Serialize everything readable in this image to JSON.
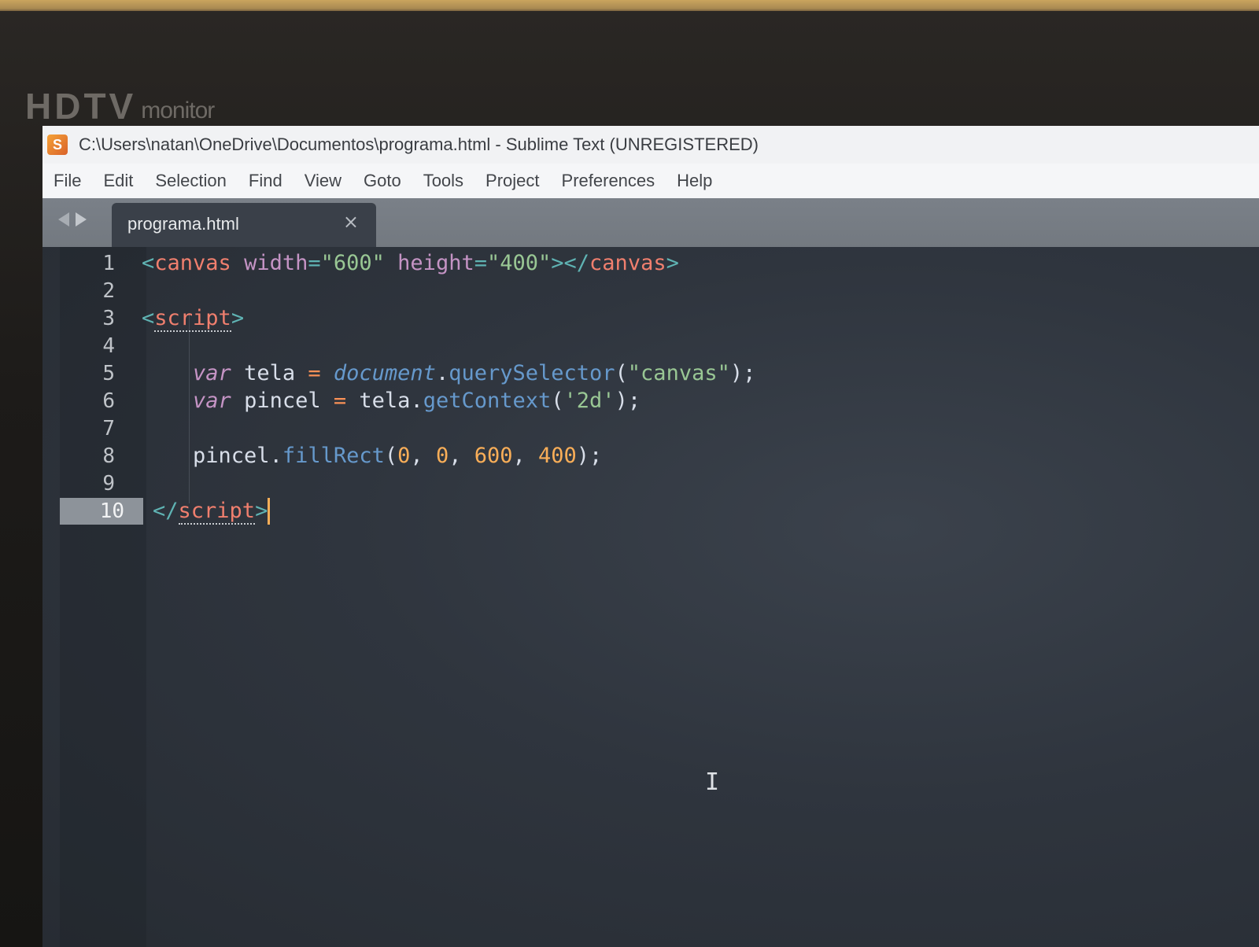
{
  "monitor": {
    "brand_big": "HDTV",
    "brand_small": "monitor"
  },
  "window": {
    "icon": "S",
    "title": "C:\\Users\\natan\\OneDrive\\Documentos\\programa.html - Sublime Text (UNREGISTERED)"
  },
  "menu": [
    "File",
    "Edit",
    "Selection",
    "Find",
    "View",
    "Goto",
    "Tools",
    "Project",
    "Preferences",
    "Help"
  ],
  "tabs": [
    {
      "label": "programa.html",
      "close_icon": "×",
      "active": true
    }
  ],
  "editor": {
    "active_line": 10,
    "lines": [
      {
        "n": "1",
        "tokens": [
          {
            "t": "<",
            "c": "punct"
          },
          {
            "t": "canvas",
            "c": "tag"
          },
          {
            "t": " ",
            "c": "p"
          },
          {
            "t": "width",
            "c": "attr"
          },
          {
            "t": "=",
            "c": "punct"
          },
          {
            "t": "\"600\"",
            "c": "str"
          },
          {
            "t": " ",
            "c": "p"
          },
          {
            "t": "height",
            "c": "attr"
          },
          {
            "t": "=",
            "c": "punct"
          },
          {
            "t": "\"400\"",
            "c": "str"
          },
          {
            "t": "></",
            "c": "punct"
          },
          {
            "t": "canvas",
            "c": "tag"
          },
          {
            "t": ">",
            "c": "punct"
          }
        ]
      },
      {
        "n": "2",
        "tokens": []
      },
      {
        "n": "3",
        "tokens": [
          {
            "t": "<",
            "c": "punct"
          },
          {
            "t": "script",
            "c": "tag underline-dotted"
          },
          {
            "t": ">",
            "c": "punct"
          }
        ]
      },
      {
        "n": "4",
        "tokens": []
      },
      {
        "n": "5",
        "tokens": [
          {
            "t": "    ",
            "c": "p"
          },
          {
            "t": "var",
            "c": "kw"
          },
          {
            "t": " ",
            "c": "p"
          },
          {
            "t": "tela",
            "c": "ident"
          },
          {
            "t": " = ",
            "c": "op"
          },
          {
            "t": "document",
            "c": "obj"
          },
          {
            "t": ".",
            "c": "p"
          },
          {
            "t": "querySelector",
            "c": "fn"
          },
          {
            "t": "(",
            "c": "p"
          },
          {
            "t": "\"canvas\"",
            "c": "str"
          },
          {
            "t": ");",
            "c": "p"
          }
        ]
      },
      {
        "n": "6",
        "tokens": [
          {
            "t": "    ",
            "c": "p"
          },
          {
            "t": "var",
            "c": "kw"
          },
          {
            "t": " ",
            "c": "p"
          },
          {
            "t": "pincel",
            "c": "ident"
          },
          {
            "t": " = ",
            "c": "op"
          },
          {
            "t": "tela",
            "c": "ident"
          },
          {
            "t": ".",
            "c": "p"
          },
          {
            "t": "getContext",
            "c": "fn"
          },
          {
            "t": "(",
            "c": "p"
          },
          {
            "t": "'2d'",
            "c": "str"
          },
          {
            "t": ");",
            "c": "p"
          }
        ]
      },
      {
        "n": "7",
        "tokens": []
      },
      {
        "n": "8",
        "tokens": [
          {
            "t": "    ",
            "c": "p"
          },
          {
            "t": "pincel",
            "c": "ident"
          },
          {
            "t": ".",
            "c": "p"
          },
          {
            "t": "fillRect",
            "c": "fn"
          },
          {
            "t": "(",
            "c": "p"
          },
          {
            "t": "0",
            "c": "num"
          },
          {
            "t": ", ",
            "c": "p"
          },
          {
            "t": "0",
            "c": "num"
          },
          {
            "t": ", ",
            "c": "p"
          },
          {
            "t": "600",
            "c": "num"
          },
          {
            "t": ", ",
            "c": "p"
          },
          {
            "t": "400",
            "c": "num"
          },
          {
            "t": ");",
            "c": "p"
          }
        ]
      },
      {
        "n": "9",
        "tokens": []
      },
      {
        "n": "10",
        "tokens": [
          {
            "t": "</",
            "c": "punct"
          },
          {
            "t": "script",
            "c": "tag underline-dotted"
          },
          {
            "t": ">",
            "c": "punct"
          }
        ]
      }
    ],
    "mouse_cursor": "I"
  }
}
